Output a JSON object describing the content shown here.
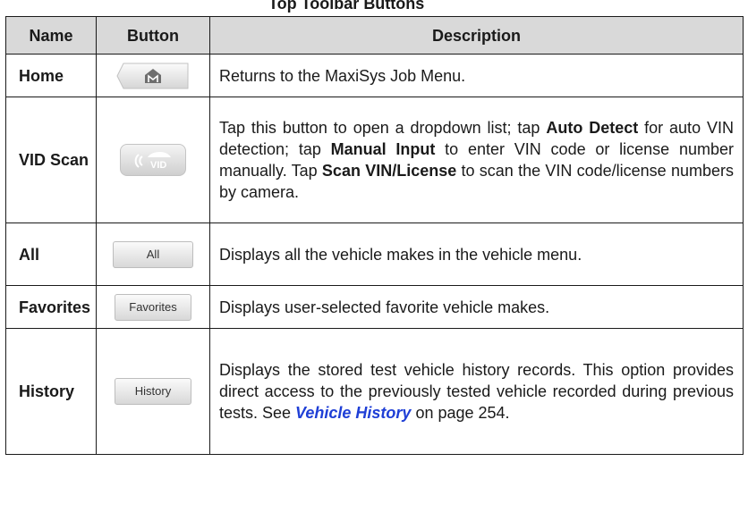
{
  "caption": "Top Toolbar Buttons",
  "headers": {
    "name": "Name",
    "button": "Button",
    "description": "Description"
  },
  "rows": [
    {
      "name": "Home",
      "button_icon": "home-m-icon",
      "description": "Returns to the MaxiSys Job Menu."
    },
    {
      "name": "VID Scan",
      "button_icon": "vid-scan-icon",
      "button_text": "VID",
      "desc_1": "Tap this button to open a dropdown list; tap ",
      "desc_auto": "Auto Detect",
      "desc_2": " for auto VIN detection; tap ",
      "desc_manual": "Manual Input",
      "desc_3": " to enter VIN code or license number manually. Tap ",
      "desc_scan": "Scan VIN/License",
      "desc_4": " to scan the VIN code/license numbers by camera."
    },
    {
      "name": "All",
      "button_text": "All",
      "description": "Displays all the vehicle makes in the vehicle menu."
    },
    {
      "name": "Favorites",
      "button_text": "Favorites",
      "description": "Displays user-selected favorite vehicle makes."
    },
    {
      "name": "History",
      "button_text": "History",
      "desc_1": "Displays the stored test vehicle history records. This option provides direct access to the previously tested vehicle recorded during previous tests. See ",
      "desc_link": "Vehicle History",
      "desc_2": " on page 254."
    }
  ],
  "colors": {
    "header_bg": "#d9d9d9",
    "link": "#1f3fd6",
    "border": "#1a1a1a"
  }
}
